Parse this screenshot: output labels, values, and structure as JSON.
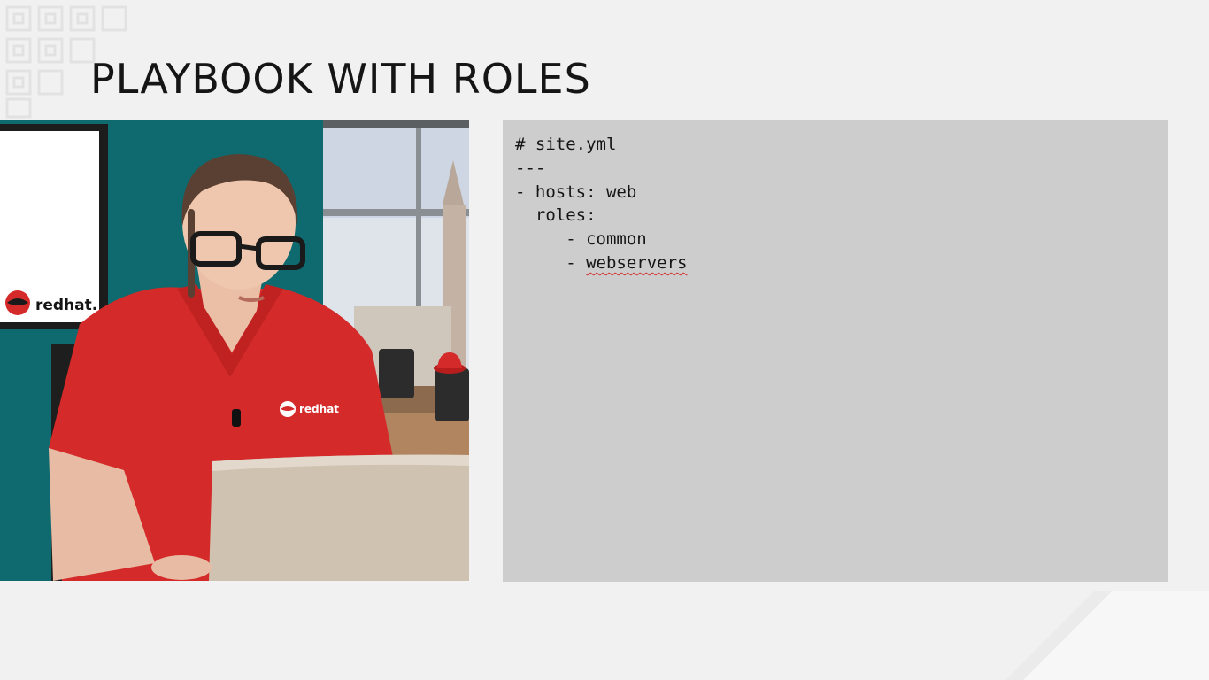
{
  "slide": {
    "title": "PLAYBOOK WITH ROLES"
  },
  "video": {
    "logo_text": "redhat.",
    "shirt_logo_text": "redhat"
  },
  "code": {
    "lines": [
      {
        "prefix": "# site.yml",
        "word": ""
      },
      {
        "prefix": "---",
        "word": ""
      },
      {
        "prefix": "- hosts: web",
        "word": ""
      },
      {
        "prefix": "  roles:",
        "word": ""
      },
      {
        "prefix": "     - common",
        "word": ""
      },
      {
        "prefix": "     - ",
        "word": "webservers"
      }
    ]
  },
  "colors": {
    "background": "#f1f1f1",
    "code_panel": "#cdcdcd",
    "teal_wall": "#0e6a6e",
    "shirt_red": "#d42a2a"
  }
}
